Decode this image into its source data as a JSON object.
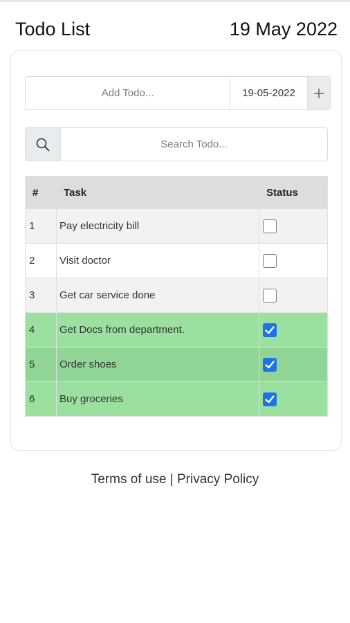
{
  "header": {
    "title": "Todo List",
    "date": "19 May 2022"
  },
  "add_todo": {
    "placeholder": "Add Todo...",
    "date_value": "19-05-2022",
    "add_icon": "plus-icon"
  },
  "search": {
    "placeholder": "Search Todo...",
    "icon": "search-icon"
  },
  "table": {
    "columns": [
      "#",
      "Task",
      "Status"
    ],
    "rows": [
      {
        "num": "1",
        "task": "Pay electricity bill",
        "done": false
      },
      {
        "num": "2",
        "task": "Visit doctor",
        "done": false
      },
      {
        "num": "3",
        "task": "Get car service done",
        "done": false
      },
      {
        "num": "4",
        "task": "Get Docs from department.",
        "done": true
      },
      {
        "num": "5",
        "task": "Order shoes",
        "done": true
      },
      {
        "num": "6",
        "task": "Buy groceries",
        "done": true
      }
    ]
  },
  "footer": {
    "terms": "Terms of use",
    "separator": " | ",
    "privacy": "Privacy Policy"
  },
  "colors": {
    "done_row": "#9be09f",
    "checkbox_checked": "#1a73e8",
    "header_bg": "#dddddd"
  }
}
